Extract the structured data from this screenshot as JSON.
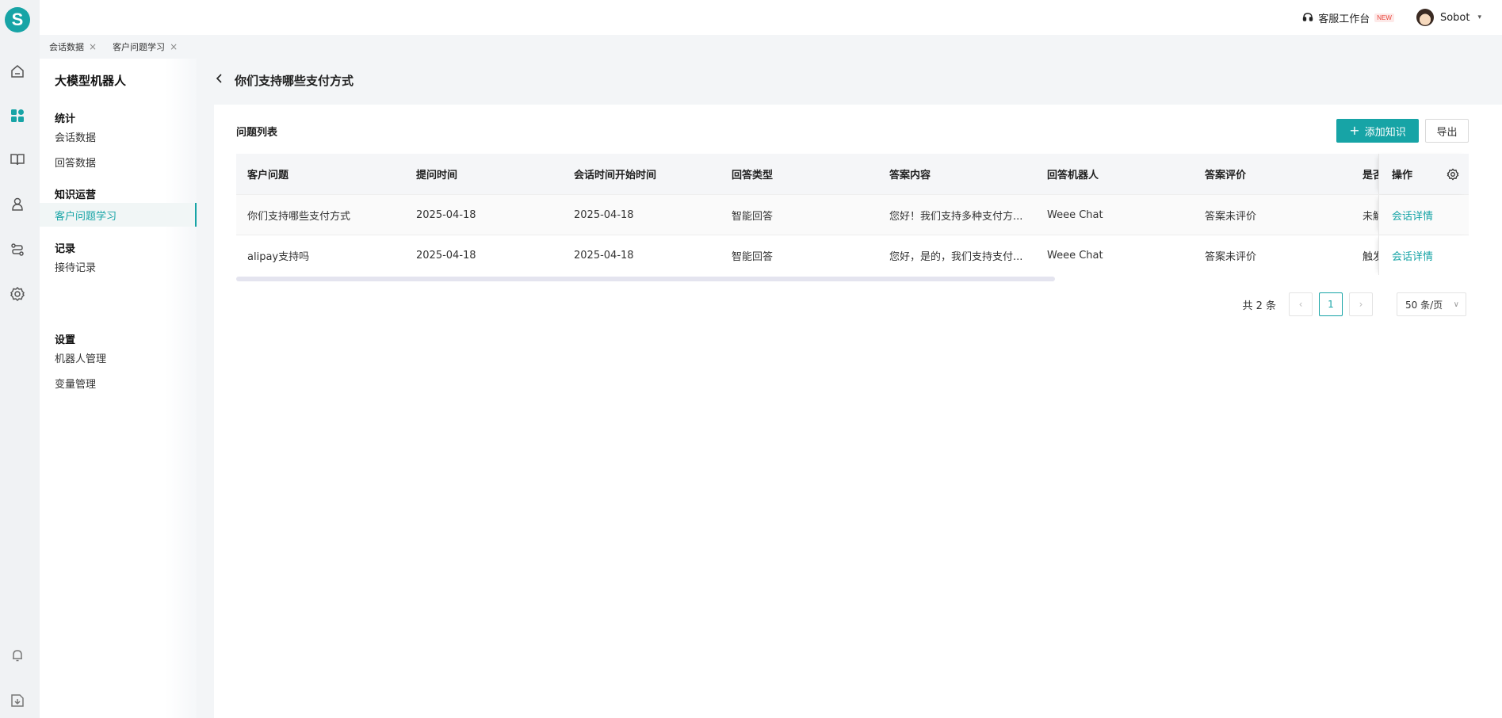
{
  "brand": {
    "logo_letter": "S",
    "accent": "#17a4a6"
  },
  "rail": {
    "icons": [
      "home-icon",
      "dashboard-icon",
      "book-icon",
      "robot-icon",
      "flow-icon",
      "settings-icon",
      "bell-icon",
      "download-icon"
    ]
  },
  "topbar": {
    "workbench_label": "客服工作台",
    "new_badge": "NEW",
    "user_name": "Sobot"
  },
  "tabs": [
    {
      "label": "会话数据"
    },
    {
      "label": "客户问题学习"
    }
  ],
  "sidenav": {
    "title": "大模型机器人",
    "groups": [
      {
        "title": "统计",
        "items": [
          "会话数据",
          "回答数据"
        ]
      },
      {
        "title": "知识运营",
        "items": [
          "客户问题学习"
        ]
      },
      {
        "title": "记录",
        "items": [
          "接待记录"
        ]
      },
      {
        "title": "设置",
        "items": [
          "机器人管理",
          "变量管理"
        ]
      }
    ],
    "active_item": "客户问题学习"
  },
  "page": {
    "title": "你们支持哪些支付方式"
  },
  "card": {
    "title": "问题列表",
    "add_button": "添加知识",
    "export_button": "导出"
  },
  "table": {
    "columns": [
      "客户问题",
      "提问时间",
      "会话时间开始时间",
      "回答类型",
      "答案内容",
      "回答机器人",
      "答案评价",
      "是否",
      "操作"
    ],
    "rows": [
      {
        "question": "你们支持哪些支付方式",
        "ask_time": "2025-04-18",
        "session_start": "2025-04-18",
        "answer_type": "智能回答",
        "answer": "您好！我们支持多种支付方...",
        "robot": "Weee Chat",
        "rating": "答案未评价",
        "flag": "未解",
        "action": "会话详情"
      },
      {
        "question": "alipay支持吗",
        "ask_time": "2025-04-18",
        "session_start": "2025-04-18",
        "answer_type": "智能回答",
        "answer": "您好，是的，我们支持支付...",
        "robot": "Weee Chat",
        "rating": "答案未评价",
        "flag": "触发",
        "action": "会话详情"
      }
    ]
  },
  "pagination": {
    "total_text": "共 2 条",
    "current_page": "1",
    "page_size": "50 条/页"
  }
}
